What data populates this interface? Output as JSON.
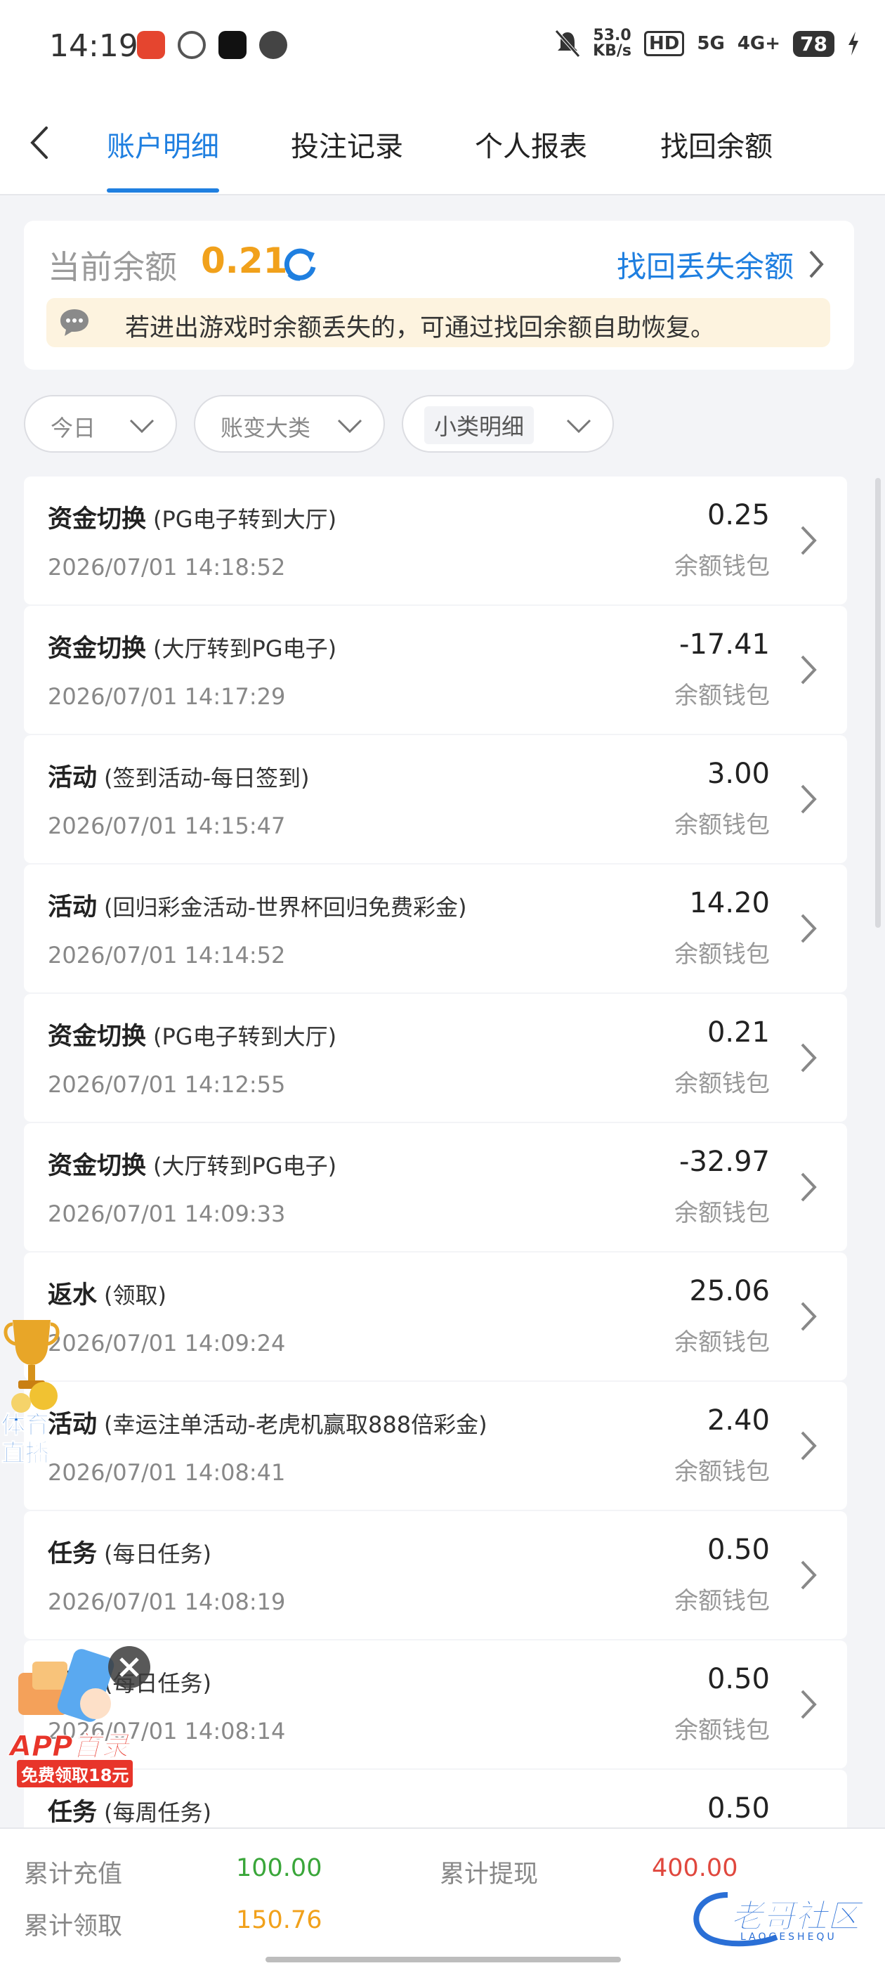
{
  "status_bar": {
    "time": "14:19",
    "net_speed": "53.0",
    "net_unit": "KB/s",
    "hd": "HD",
    "sig1": "5G",
    "sig2": "4G+",
    "battery": "78"
  },
  "tabs": [
    {
      "label": "账户明细",
      "active": true
    },
    {
      "label": "投注记录",
      "active": false
    },
    {
      "label": "个人报表",
      "active": false
    },
    {
      "label": "找回余额",
      "active": false
    }
  ],
  "balance": {
    "label": "当前余额",
    "value": "0.21",
    "recover_link": "找回丢失余额",
    "notice": "若进出游戏时余额丢失的，可通过找回余额自助恢复。"
  },
  "filters": [
    {
      "label": "今日"
    },
    {
      "label": "账变大类"
    },
    {
      "label": "小类明细"
    }
  ],
  "records": [
    {
      "title": "资金切换",
      "detail": "(PG电子转到大厅)",
      "time": "2026/07/01 14:18:52",
      "amount": "0.25",
      "wallet": "余额钱包"
    },
    {
      "title": "资金切换",
      "detail": "(大厅转到PG电子)",
      "time": "2026/07/01 14:17:29",
      "amount": "-17.41",
      "wallet": "余额钱包"
    },
    {
      "title": "活动",
      "detail": "(签到活动-每日签到)",
      "time": "2026/07/01 14:15:47",
      "amount": "3.00",
      "wallet": "余额钱包"
    },
    {
      "title": "活动",
      "detail": "(回归彩金活动-世界杯回归免费彩金)",
      "time": "2026/07/01 14:14:52",
      "amount": "14.20",
      "wallet": "余额钱包"
    },
    {
      "title": "资金切换",
      "detail": "(PG电子转到大厅)",
      "time": "2026/07/01 14:12:55",
      "amount": "0.21",
      "wallet": "余额钱包"
    },
    {
      "title": "资金切换",
      "detail": "(大厅转到PG电子)",
      "time": "2026/07/01 14:09:33",
      "amount": "-32.97",
      "wallet": "余额钱包"
    },
    {
      "title": "返水",
      "detail": "(领取)",
      "time": "2026/07/01 14:09:24",
      "amount": "25.06",
      "wallet": "余额钱包"
    },
    {
      "title": "活动",
      "detail": "(幸运注单活动-老虎机赢取888倍彩金)",
      "time": "2026/07/01 14:08:41",
      "amount": "2.40",
      "wallet": "余额钱包"
    },
    {
      "title": "任务",
      "detail": "(每日任务)",
      "time": "2026/07/01 14:08:19",
      "amount": "0.50",
      "wallet": "余额钱包"
    },
    {
      "title": "任务",
      "detail": "(每日任务)",
      "time": "2026/07/01 14:08:14",
      "amount": "0.50",
      "wallet": "余额钱包"
    },
    {
      "title": "任务",
      "detail": "(每周任务)",
      "time": "",
      "amount": "0.50",
      "wallet": ""
    }
  ],
  "float_ads": {
    "sports_line1": "体育",
    "sports_line2": "直播",
    "app_title": "APP首录",
    "app_sub": "免费领取18元"
  },
  "summary": {
    "deposit_label": "累计充值",
    "deposit_value": "100.00",
    "withdraw_label": "累计提现",
    "withdraw_value": "400.00",
    "claim_label": "累计领取",
    "claim_value": "150.76"
  },
  "watermark": {
    "text": "老哥社区",
    "sub": "LAOGESHEQU"
  },
  "colors": {
    "accent": "#1f7fe0",
    "balance": "#f1a11b",
    "deposit": "#3aa63a",
    "withdraw": "#e0483e",
    "claim": "#f1a11b"
  }
}
